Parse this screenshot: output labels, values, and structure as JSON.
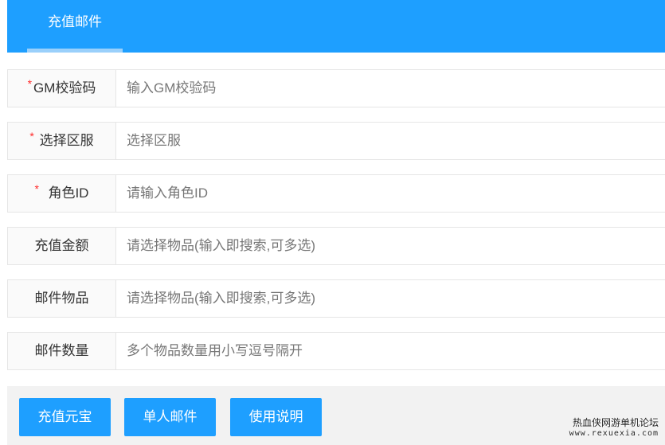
{
  "header": {
    "tab_label": "充值邮件"
  },
  "form": {
    "required_mark": "*",
    "rows": [
      {
        "label": "GM校验码",
        "required": true,
        "placeholder": "输入GM校验码"
      },
      {
        "label": "选择区服",
        "required": true,
        "placeholder": "选择区服"
      },
      {
        "label": "角色ID",
        "required": true,
        "placeholder": "请输入角色ID"
      },
      {
        "label": "充值金额",
        "required": false,
        "placeholder": "请选择物品(输入即搜索,可多选)"
      },
      {
        "label": "邮件物品",
        "required": false,
        "placeholder": "请选择物品(输入即搜索,可多选)"
      },
      {
        "label": "邮件数量",
        "required": false,
        "placeholder": "多个物品数量用小写逗号隔开"
      }
    ]
  },
  "footer": {
    "buttons": [
      {
        "label": "充值元宝"
      },
      {
        "label": "单人邮件"
      },
      {
        "label": "使用说明"
      }
    ]
  },
  "watermark": {
    "line1": "热血侠网游单机论坛",
    "line2": "www.rexuexia.com"
  },
  "colors": {
    "accent": "#1e9fff",
    "required": "#ff2a2a",
    "footer_bg": "#f2f2f2"
  }
}
